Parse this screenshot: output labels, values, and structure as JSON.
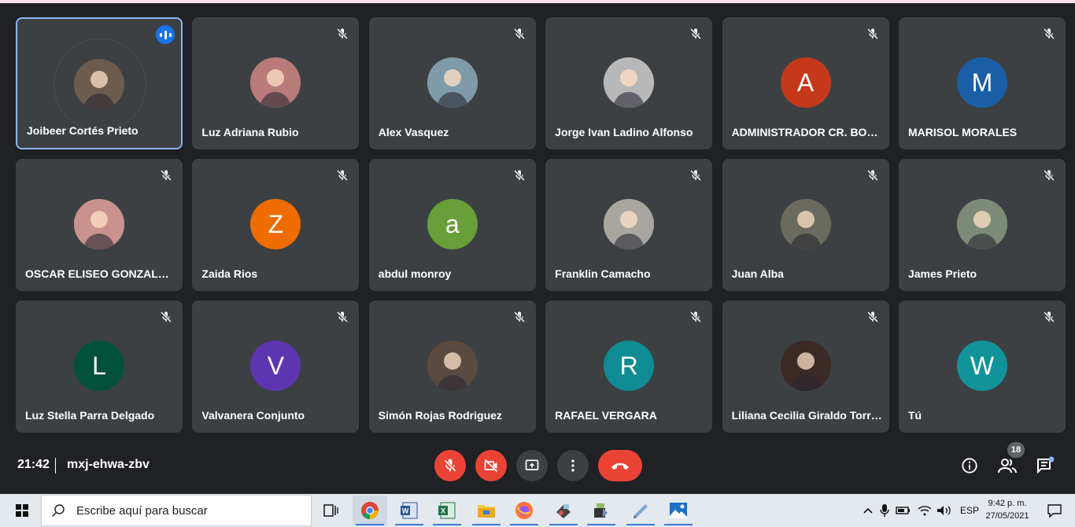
{
  "meeting": {
    "time": "21:42",
    "code": "mxj-ehwa-zbv",
    "participant_count": "18",
    "colors": {
      "background": "#202124",
      "tile": "#3c4043",
      "danger": "#ea4335",
      "accent": "#1a73e8"
    }
  },
  "participants": [
    {
      "name": "Joibeer Cortés Prieto",
      "avatar": "photo",
      "color": "#6d5b4e",
      "status": "speaking"
    },
    {
      "name": "Luz Adriana Rubio",
      "avatar": "photo",
      "color": "#b97a7a",
      "status": "muted"
    },
    {
      "name": "Alex Vasquez",
      "avatar": "photo",
      "color": "#7f9aa8",
      "status": "muted"
    },
    {
      "name": "Jorge Ivan Ladino Alfonso",
      "avatar": "photo",
      "color": "#b8b8b8",
      "status": "muted"
    },
    {
      "name": "ADMINISTRADOR CR. BON...",
      "avatar": "A",
      "color": "#c5391a",
      "status": "muted"
    },
    {
      "name": "MARISOL MORALES",
      "avatar": "M",
      "color": "#1a5ea6",
      "status": "muted"
    },
    {
      "name": "OSCAR ELISEO GONZALEZ...",
      "avatar": "photo",
      "color": "#c9928f",
      "status": "muted"
    },
    {
      "name": "Zaida Rios",
      "avatar": "Z",
      "color": "#ef6c00",
      "status": "muted"
    },
    {
      "name": "abdul monroy",
      "avatar": "a",
      "color": "#689f38",
      "status": "muted"
    },
    {
      "name": "Franklin Camacho",
      "avatar": "photo",
      "color": "#a9a6a0",
      "status": "muted"
    },
    {
      "name": "Juan Alba",
      "avatar": "photo",
      "color": "#6b6a5e",
      "status": "muted"
    },
    {
      "name": "James Prieto",
      "avatar": "photo",
      "color": "#7d8a78",
      "status": "muted"
    },
    {
      "name": "Luz Stella Parra Delgado",
      "avatar": "L",
      "color": "#00513a",
      "status": "muted"
    },
    {
      "name": "Valvanera Conjunto",
      "avatar": "V",
      "color": "#5e35b1",
      "status": "muted"
    },
    {
      "name": "Simón Rojas Rodriguez",
      "avatar": "photo",
      "color": "#5a4a40",
      "status": "muted"
    },
    {
      "name": "RAFAEL VERGARA",
      "avatar": "R",
      "color": "#0f8b93",
      "status": "muted"
    },
    {
      "name": "Liliana Cecilia Giraldo Torres",
      "avatar": "photo",
      "color": "#3b2a25",
      "status": "muted"
    },
    {
      "name": "Tú",
      "avatar": "W",
      "color": "#12939a",
      "status": "muted"
    }
  ],
  "controls": {
    "mic": "mic-off-icon",
    "camera": "camera-off-icon",
    "present": "present-screen-icon",
    "more": "more-options-icon",
    "leave": "end-call-icon"
  },
  "right_controls": [
    "info-icon",
    "people-icon",
    "chat-icon"
  ],
  "taskbar": {
    "search_placeholder": "Escribe aquí para buscar",
    "apps": [
      "task-view-icon",
      "chrome-icon",
      "word-icon",
      "excel-icon",
      "file-explorer-icon",
      "firefox-icon",
      "app-icon",
      "app-icon",
      "app-icon",
      "photos-icon"
    ],
    "language": "ESP",
    "time": "9:42 p. m.",
    "date": "27/05/2021"
  }
}
